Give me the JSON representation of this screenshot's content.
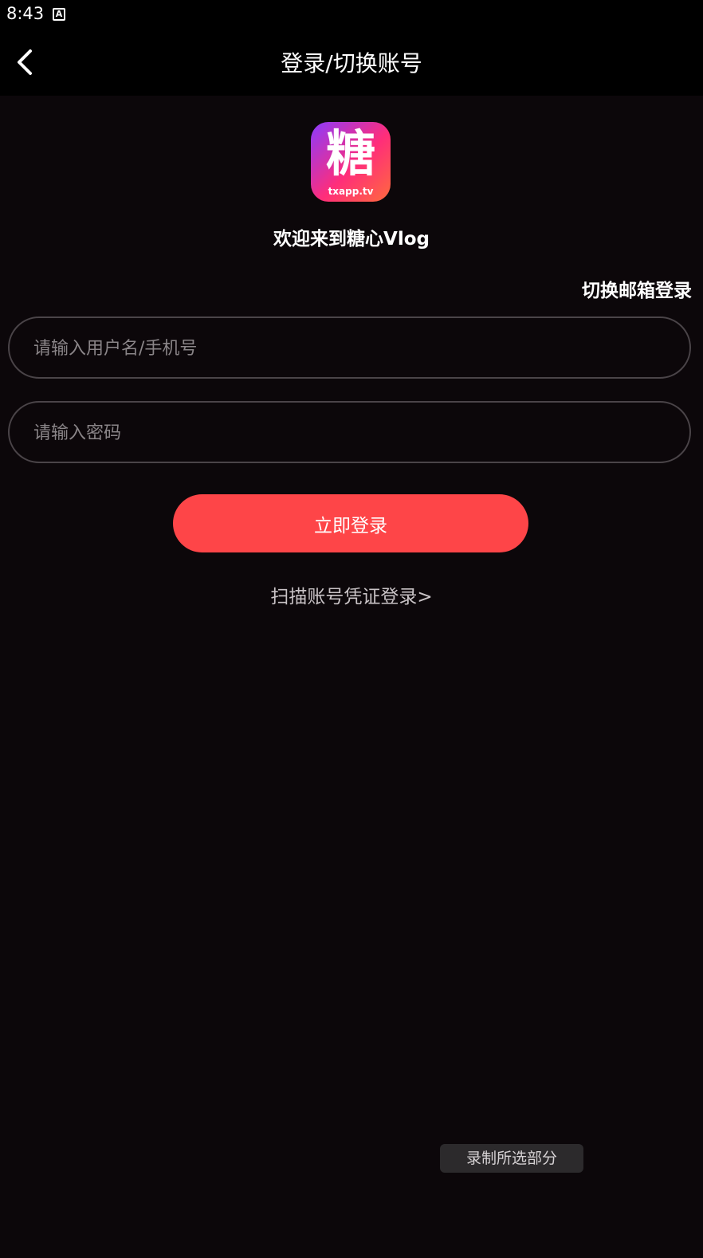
{
  "status": {
    "time": "8:43",
    "icon": "A"
  },
  "header": {
    "title": "登录/切换账号",
    "back_icon": "chevron-left-icon"
  },
  "logo": {
    "char": "糖",
    "subtitle": "txapp.tv"
  },
  "welcome": "欢迎来到糖心Vlog",
  "switch_email": "切换邮箱登录",
  "form": {
    "username_placeholder": "请输入用户名/手机号",
    "password_placeholder": "请输入密码"
  },
  "login_button": "立即登录",
  "scan_link": "扫描账号凭证登录>",
  "record_toast": "录制所选部分",
  "colors": {
    "accent": "#fe4548",
    "background": "#0c070a"
  }
}
